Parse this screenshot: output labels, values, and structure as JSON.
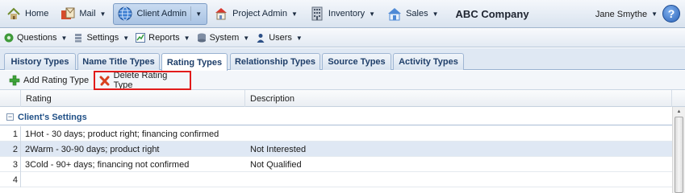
{
  "nav": {
    "items": [
      {
        "label": "Home",
        "icon": "home-icon"
      },
      {
        "label": "Mail",
        "icon": "mail-icon"
      },
      {
        "label": "Client Admin",
        "icon": "globe-icon"
      },
      {
        "label": "Project Admin",
        "icon": "project-icon"
      },
      {
        "label": "Inventory",
        "icon": "inventory-icon"
      },
      {
        "label": "Sales",
        "icon": "sales-icon"
      }
    ],
    "company": "ABC Company",
    "user": "Jane Smythe",
    "help": "?"
  },
  "subnav": {
    "items": [
      {
        "label": "Questions",
        "icon": "questions-icon"
      },
      {
        "label": "Settings",
        "icon": "settings-icon"
      },
      {
        "label": "Reports",
        "icon": "reports-icon"
      },
      {
        "label": "System",
        "icon": "system-icon"
      },
      {
        "label": "Users",
        "icon": "users-icon"
      }
    ]
  },
  "tabs": [
    {
      "label": "History Types"
    },
    {
      "label": "Name Title Types"
    },
    {
      "label": "Rating Types",
      "active": true
    },
    {
      "label": "Relationship Types"
    },
    {
      "label": "Source Types"
    },
    {
      "label": "Activity Types"
    }
  ],
  "actions": {
    "add": "Add Rating Type",
    "delete": "Delete Rating Type"
  },
  "grid": {
    "columns": [
      "Rating",
      "Description"
    ],
    "group": "Client's Settings",
    "group_toggle": "−",
    "rows": [
      {
        "num": "1",
        "rating": "1Hot - 30 days; product right; financing confirmed",
        "description": ""
      },
      {
        "num": "2",
        "rating": "2Warm - 30-90 days; product right",
        "description": "Not Interested"
      },
      {
        "num": "3",
        "rating": "3Cold - 90+ days; financing not confirmed",
        "description": "Not Qualified"
      },
      {
        "num": "4",
        "rating": "",
        "description": ""
      }
    ]
  },
  "colors": {
    "highlight_border": "#e11b1b",
    "group_label": "#1f4f86",
    "selected_row": "#dfe8f4"
  }
}
